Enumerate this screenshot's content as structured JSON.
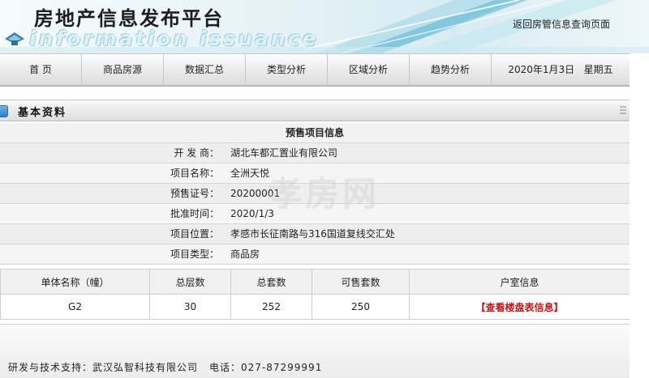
{
  "banner": {
    "title": "房地产信息发布平台",
    "subtitle": "information issuance",
    "return_link": "返回房管信息查询页面"
  },
  "nav": {
    "items": [
      {
        "label": "首  页"
      },
      {
        "label": "商品房源"
      },
      {
        "label": "数据汇总"
      },
      {
        "label": "类型分析"
      },
      {
        "label": "区域分析"
      },
      {
        "label": "趋势分析"
      }
    ],
    "date": "2020年1月3日",
    "weekday": "星期五"
  },
  "section": {
    "title": "基本资料"
  },
  "info": {
    "heading": "预售项目信息",
    "rows": [
      {
        "label": "开 发 商：",
        "value": "湖北车都汇置业有限公司"
      },
      {
        "label": "项目名称：",
        "value": "全洲天悦"
      },
      {
        "label": "预售证号：",
        "value": "20200001"
      },
      {
        "label": "批准时间：",
        "value": "2020/1/3"
      },
      {
        "label": "项目位置：",
        "value": "孝感市长征南路与316国道复线交汇处"
      },
      {
        "label": "项目类型：",
        "value": "商品房"
      }
    ]
  },
  "units": {
    "headers": [
      "单体名称（幢）",
      "总层数",
      "总套数",
      "可售套数",
      "户室信息"
    ],
    "rows": [
      {
        "name": "G2",
        "floors": "30",
        "total": "252",
        "available": "250",
        "link_open": "【",
        "link": "查看楼盘表信息",
        "link_close": "】"
      }
    ]
  },
  "footer": {
    "support": "研发与技术支持：武汉弘智科技有限公司",
    "phone": "电话：027-87299991"
  },
  "watermark": "孝房网",
  "colors": {
    "link_red": "#c2161a",
    "section_icon_blue": "#2b7fc6"
  }
}
